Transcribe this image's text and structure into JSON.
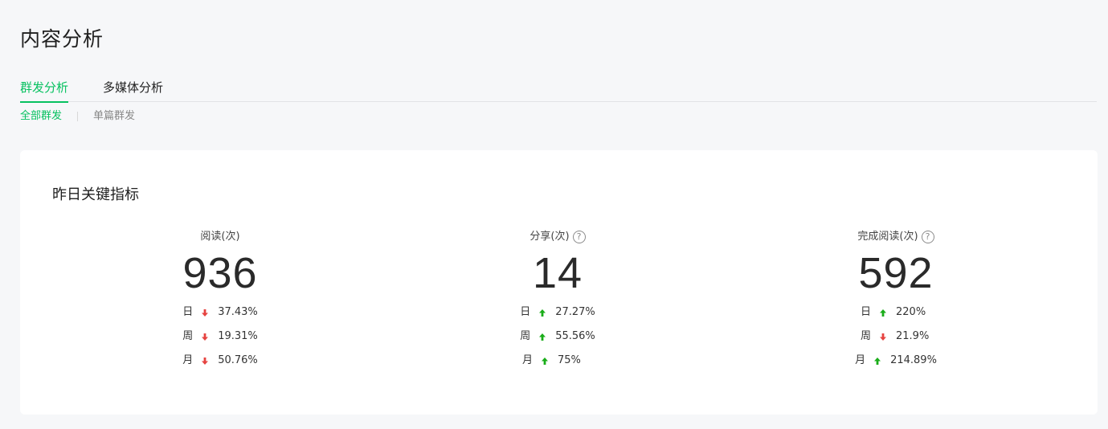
{
  "page": {
    "title": "内容分析"
  },
  "tabs": [
    {
      "label": "群发分析",
      "active": true
    },
    {
      "label": "多媒体分析",
      "active": false
    }
  ],
  "subtabs": [
    {
      "label": "全部群发",
      "active": true
    },
    {
      "label": "单篇群发",
      "active": false
    }
  ],
  "card": {
    "title": "昨日关键指标"
  },
  "metrics": [
    {
      "label": "阅读(次)",
      "has_help": false,
      "value": "936",
      "changes": [
        {
          "period": "日",
          "direction": "down",
          "value": "37.43%"
        },
        {
          "period": "周",
          "direction": "down",
          "value": "19.31%"
        },
        {
          "period": "月",
          "direction": "down",
          "value": "50.76%"
        }
      ]
    },
    {
      "label": "分享(次)",
      "has_help": true,
      "value": "14",
      "changes": [
        {
          "period": "日",
          "direction": "up",
          "value": "27.27%"
        },
        {
          "period": "周",
          "direction": "up",
          "value": "55.56%"
        },
        {
          "period": "月",
          "direction": "up",
          "value": "75%"
        }
      ]
    },
    {
      "label": "完成阅读(次)",
      "has_help": true,
      "value": "592",
      "changes": [
        {
          "period": "日",
          "direction": "up",
          "value": "220%"
        },
        {
          "period": "周",
          "direction": "down",
          "value": "21.9%"
        },
        {
          "period": "月",
          "direction": "up",
          "value": "214.89%"
        }
      ]
    }
  ],
  "icons": {
    "help": "?"
  },
  "colors": {
    "accent": "#07c160",
    "up": "#1aad19",
    "down": "#e64340",
    "background": "#f6f7f9",
    "card": "#ffffff"
  }
}
